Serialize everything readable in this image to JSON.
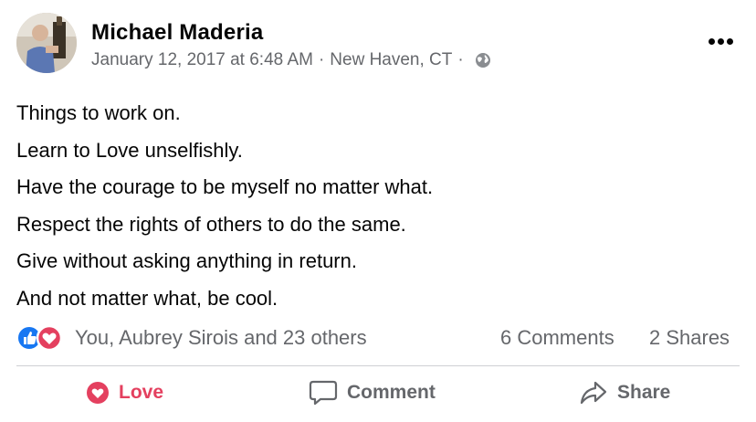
{
  "post": {
    "author": "Michael Maderia",
    "date": "January 12, 2017 at 6:48 AM",
    "separator": "·",
    "location": "New Haven, CT",
    "privacy_icon": "globe-icon",
    "menu_icon": "more-options-icon",
    "lines": [
      "Things to work on.",
      "Learn to Love unselfishly.",
      "Have the courage to be myself no matter what.",
      "Respect the rights of others to do the same.",
      "Give without asking anything in return.",
      "And not matter what, be cool."
    ]
  },
  "stats": {
    "reactors": "You, Aubrey Sirois and 23 others",
    "comments": "6 Comments",
    "shares": "2 Shares",
    "reaction_icons": [
      "like-reaction-icon",
      "love-reaction-icon"
    ]
  },
  "actions": {
    "love_label": "Love",
    "comment_label": "Comment",
    "share_label": "Share"
  },
  "colors": {
    "like_blue": "#1877f2",
    "love_red": "#e4405f",
    "secondary_text": "#65676b",
    "primary_text": "#050505"
  }
}
